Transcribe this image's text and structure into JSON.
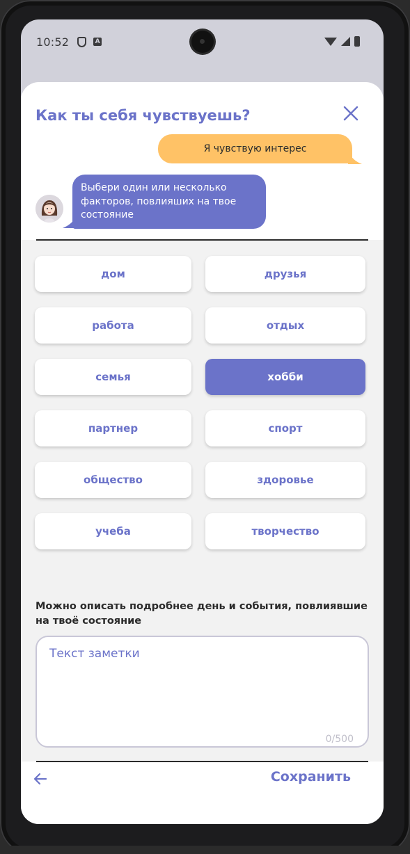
{
  "status_bar": {
    "time": "10:52"
  },
  "sheet": {
    "title": "Как ты себя чувствуешь?",
    "user_message": "Я чувствую интерес",
    "bot_message": "Выбери один или несколько факторов, повлияших на твое состояние"
  },
  "factors": [
    {
      "label": "дом",
      "selected": false
    },
    {
      "label": "друзья",
      "selected": false
    },
    {
      "label": "работа",
      "selected": false
    },
    {
      "label": "отдых",
      "selected": false
    },
    {
      "label": "семья",
      "selected": false
    },
    {
      "label": "хобби",
      "selected": true
    },
    {
      "label": "партнер",
      "selected": false
    },
    {
      "label": "спорт",
      "selected": false
    },
    {
      "label": "общество",
      "selected": false
    },
    {
      "label": "здоровье",
      "selected": false
    },
    {
      "label": "учеба",
      "selected": false
    },
    {
      "label": "творчество",
      "selected": false
    }
  ],
  "note": {
    "label": "Можно описать подробнее день и события, повлиявшие на твоё состояние",
    "placeholder": "Текст заметки",
    "counter": "0/500"
  },
  "footer": {
    "save_label": "Сохранить"
  },
  "colors": {
    "accent": "#6b73c9",
    "user_bubble": "#ffc266",
    "background": "#f2f2f2"
  }
}
